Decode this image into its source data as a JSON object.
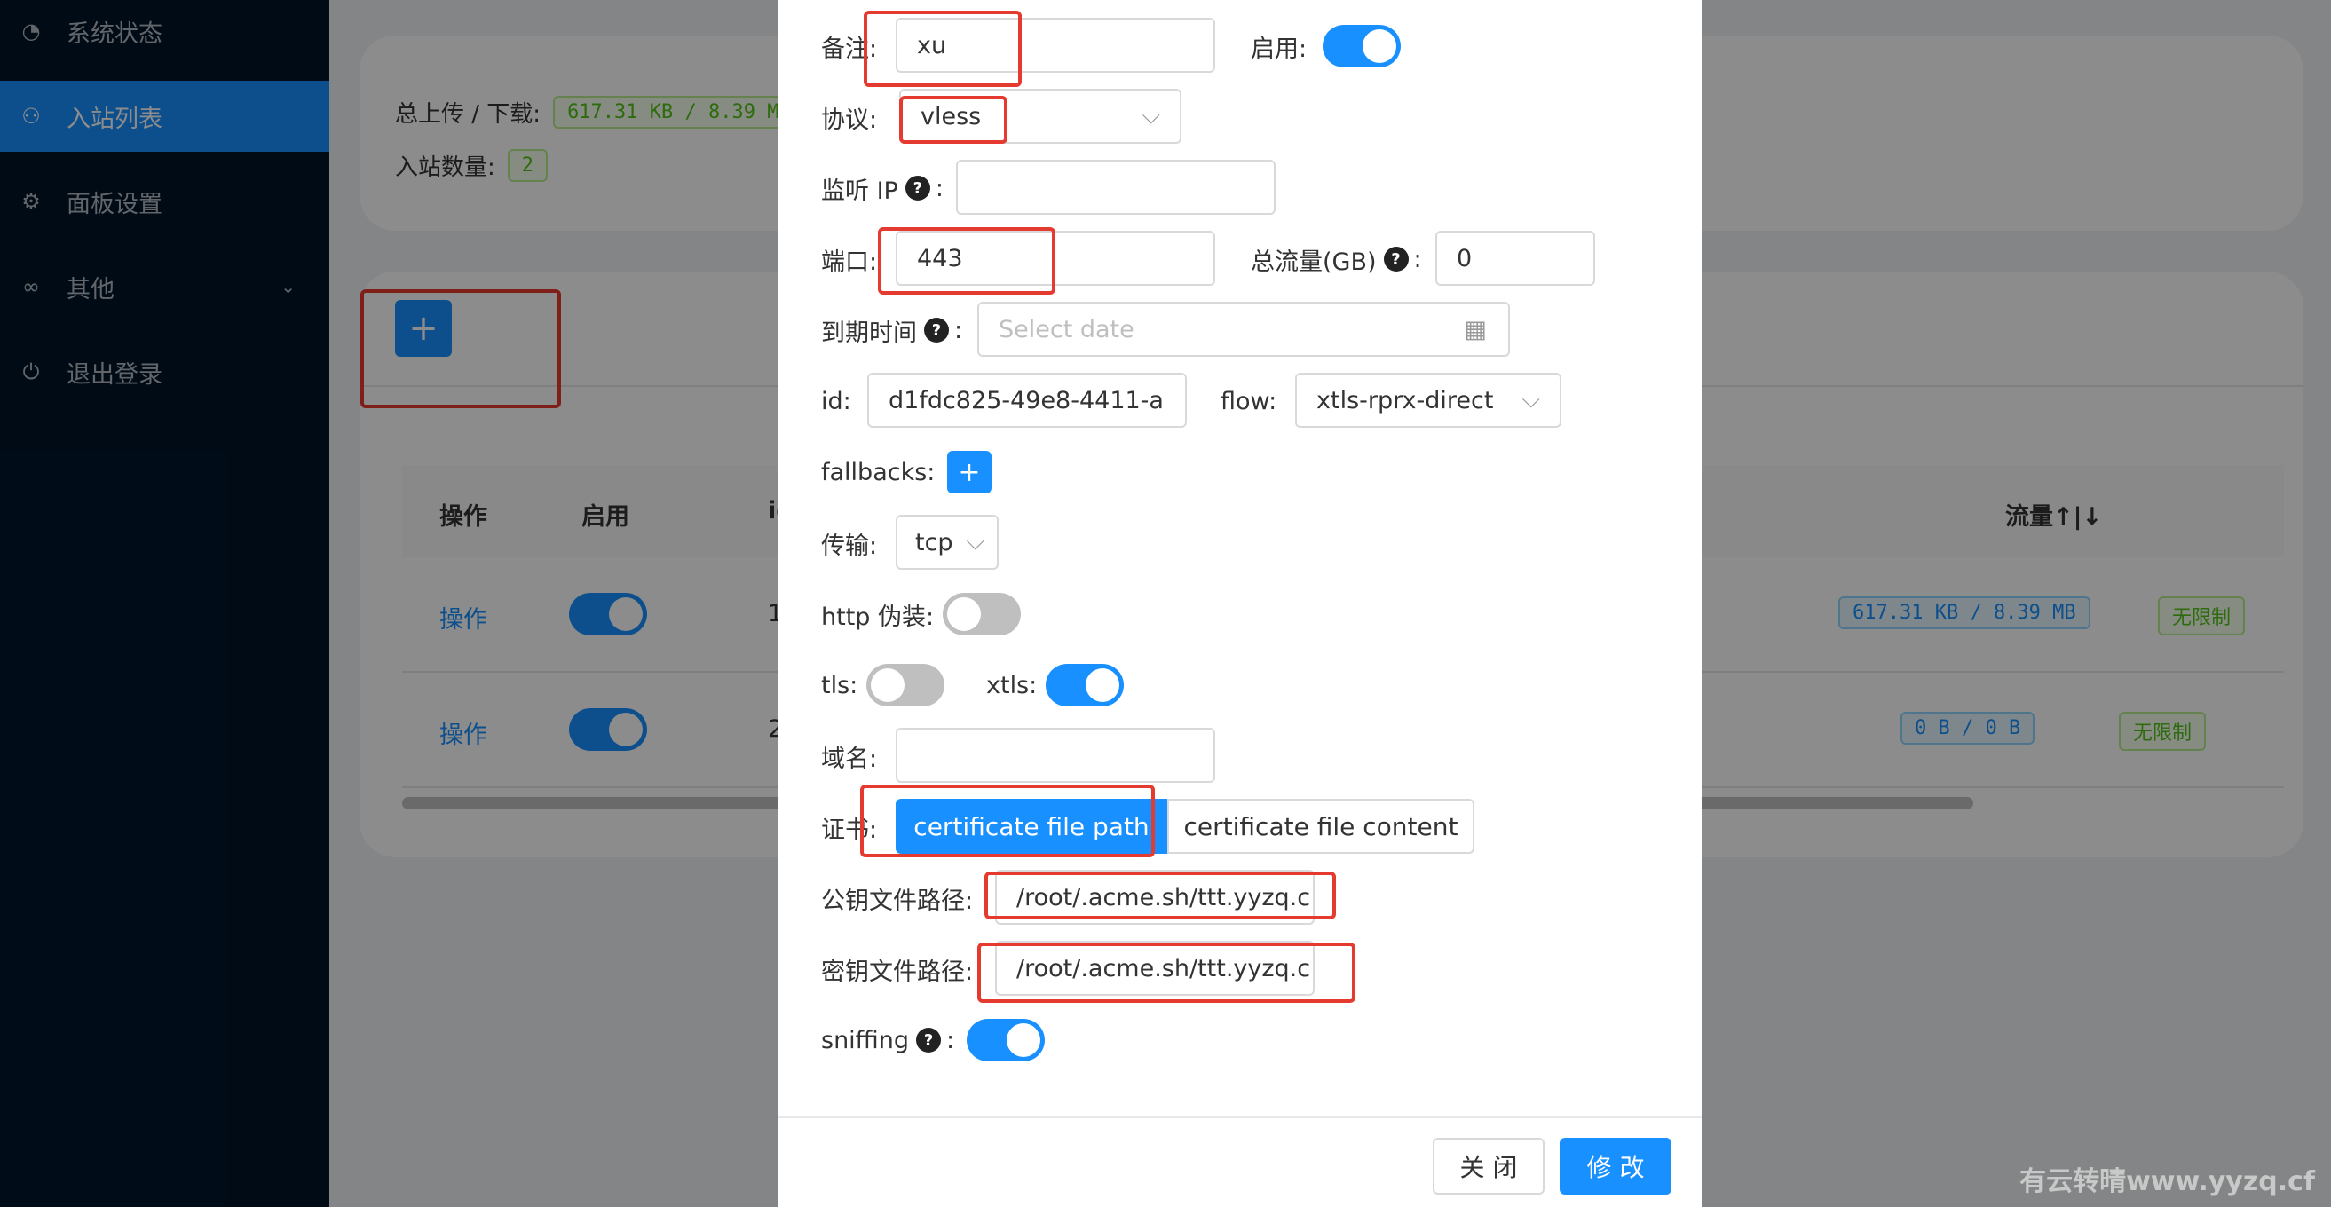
{
  "sidebar": {
    "items": [
      {
        "label": "系统状态",
        "icon": "dashboard-icon"
      },
      {
        "label": "入站列表",
        "icon": "user-icon"
      },
      {
        "label": "面板设置",
        "icon": "gear-icon"
      },
      {
        "label": "其他",
        "icon": "link-icon"
      },
      {
        "label": "退出登录",
        "icon": "logout-icon"
      }
    ]
  },
  "stats": {
    "traffic_label": "总上传 / 下载:",
    "traffic_value": "617.31 KB / 8.39 M",
    "count_label": "入站数量:",
    "count_value": "2"
  },
  "table": {
    "add_button": "+",
    "headers": {
      "op": "操作",
      "enable": "启用",
      "id": "id",
      "traffic": "流量↑|↓"
    },
    "rows": [
      {
        "op": "操作",
        "id": "1",
        "traffic": "617.31 KB / 8.39 MB",
        "limit": "无限制"
      },
      {
        "op": "操作",
        "id": "2",
        "traffic": "0 B / 0 B",
        "limit": "无限制"
      }
    ]
  },
  "modal": {
    "remark_label": "备注:",
    "remark_value": "xu",
    "enable_label": "启用:",
    "protocol_label": "协议:",
    "protocol_value": "vless",
    "listen_label": "监听 IP",
    "port_label": "端口:",
    "port_value": "443",
    "total_label": "总流量(GB)",
    "total_value": "0",
    "expire_label": "到期时间",
    "expire_placeholder": "Select date",
    "id_label": "id:",
    "id_value": "d1fdc825-49e8-4411-a",
    "flow_label": "flow:",
    "flow_value": "xtls-rprx-direct",
    "fallbacks_label": "fallbacks:",
    "fallbacks_button": "+",
    "transport_label": "传输:",
    "transport_value": "tcp",
    "http_label": "http 伪装:",
    "tls_label": "tls:",
    "xtls_label": "xtls:",
    "domain_label": "域名:",
    "cert_label": "证书:",
    "cert_path_tab": "certificate file path",
    "cert_content_tab": "certificate file content",
    "pubkey_label": "公钥文件路径:",
    "pubkey_value": "/root/.acme.sh/ttt.yyzq.c",
    "privkey_label": "密钥文件路径:",
    "privkey_value": "/root/.acme.sh/ttt.yyzq.c",
    "sniffing_label": "sniffing",
    "close_button": "关 闭",
    "submit_button": "修 改"
  },
  "watermark": "有云转晴www.yyzq.cf",
  "colors": {
    "accent": "#1890ff",
    "sidebar": "#001529",
    "highlight": "#e53a2f"
  }
}
